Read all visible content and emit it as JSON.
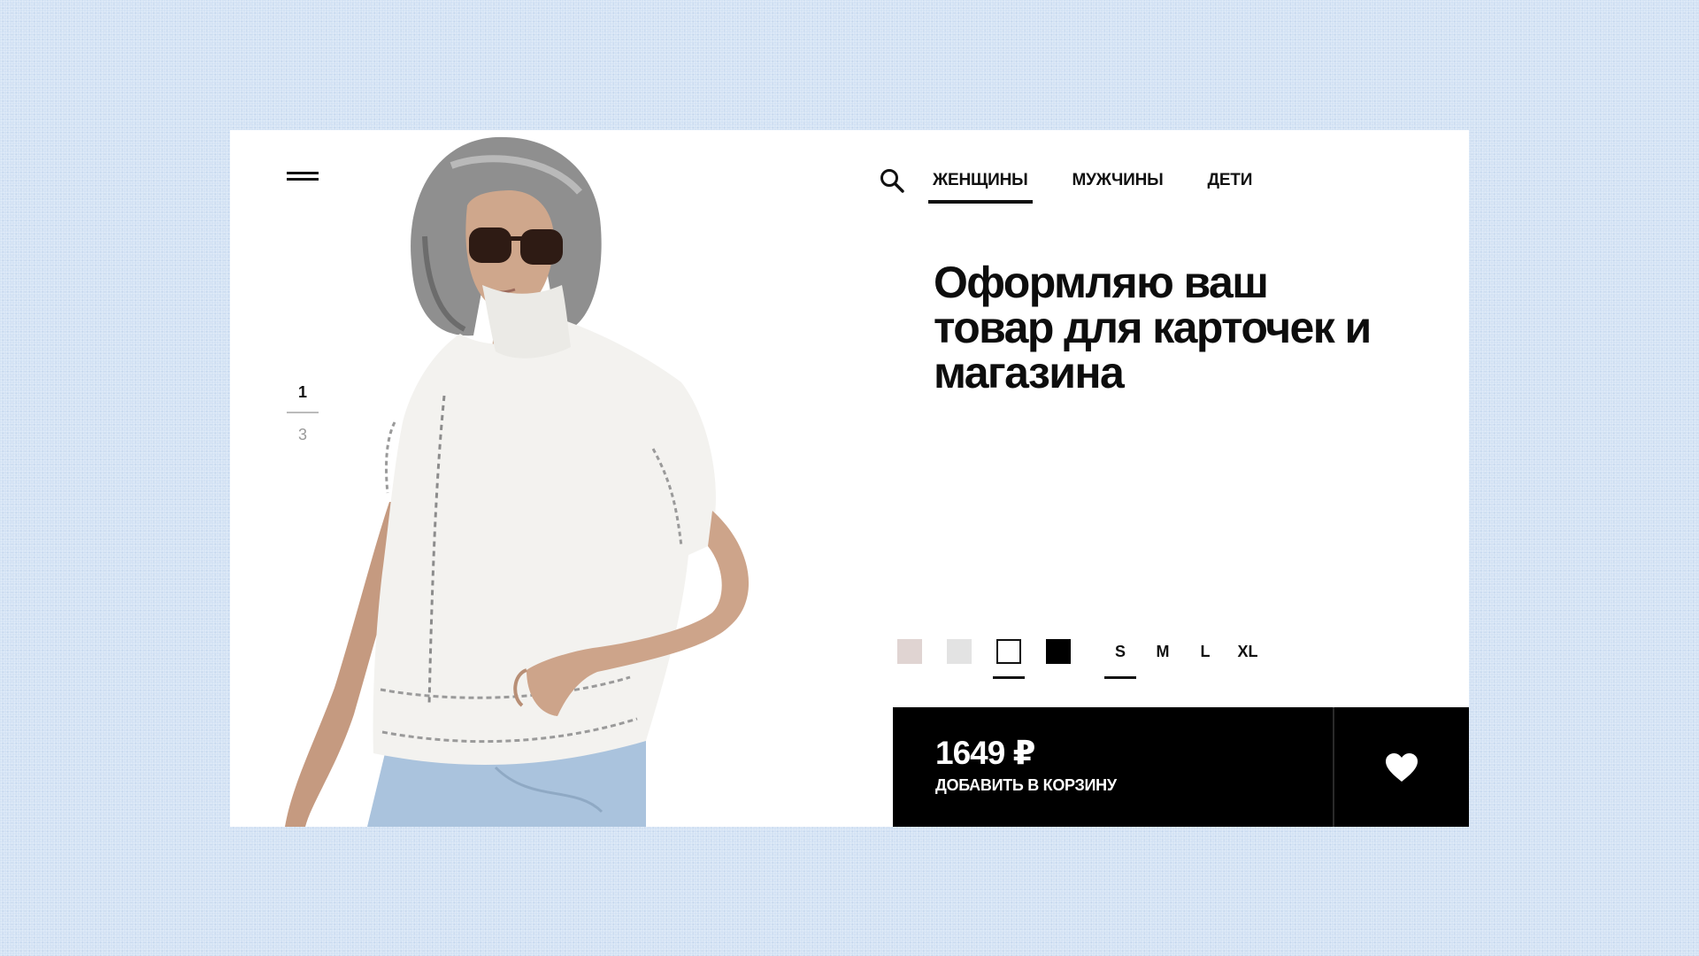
{
  "header": {
    "menu_icon": "menu-icon",
    "search_icon": "search-icon",
    "tabs": [
      {
        "label": "ЖЕНЩИНЫ",
        "active": true
      },
      {
        "label": "МУЖЧИНЫ",
        "active": false
      },
      {
        "label": "ДЕТИ",
        "active": false
      }
    ]
  },
  "pager": {
    "current": "1",
    "total": "3"
  },
  "product": {
    "headline": "Оформляю ваш товар для карточек и магазина",
    "colors": [
      {
        "name": "beige",
        "hex": "#e0d4d2",
        "selected": false
      },
      {
        "name": "light-gray",
        "hex": "#e3e3e3",
        "selected": false
      },
      {
        "name": "white",
        "hex": "#ffffff",
        "selected": true
      },
      {
        "name": "black",
        "hex": "#000000",
        "selected": false
      }
    ],
    "sizes": [
      {
        "label": "S",
        "selected": true
      },
      {
        "label": "M",
        "selected": false
      },
      {
        "label": "L",
        "selected": false
      },
      {
        "label": "XL",
        "selected": false
      }
    ],
    "price": "1649 ₽",
    "cart_label": "ДОБАВИТЬ В КОРЗИНУ",
    "favorite_icon": "heart-icon"
  },
  "colors": {
    "background": "#d3e2f4",
    "card": "#ffffff",
    "accent": "#000000"
  }
}
